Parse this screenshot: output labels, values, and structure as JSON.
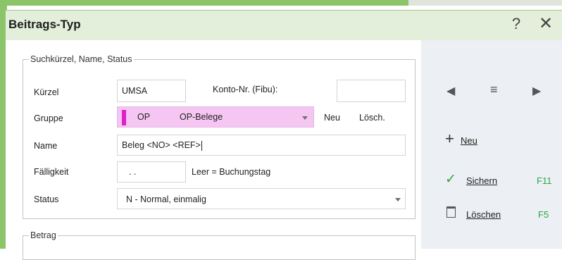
{
  "window": {
    "title": "Beitrags-Typ",
    "help_glyph": "?",
    "close_glyph": "✕"
  },
  "suchkuerzel_group": {
    "legend": "Suchkürzel, Name, Status",
    "kuerzel": {
      "label": "Kürzel",
      "value": "UMSA"
    },
    "konto": {
      "label": "Konto-Nr. (Fibu):",
      "value": ""
    },
    "gruppe": {
      "label": "Gruppe",
      "code": "OP",
      "name": "OP-Belege",
      "color": "#f6c6f2",
      "swatch_color": "#e020c8",
      "new_label": "Neu",
      "delete_label": "Lösch."
    },
    "name": {
      "label": "Name",
      "value": "Beleg <NO> <REF>"
    },
    "faelligkeit": {
      "label": "Fälligkeit",
      "value": ". .",
      "hint": "Leer = Buchungstag"
    },
    "status": {
      "label": "Status",
      "value": "N - Normal, einmalig"
    }
  },
  "betrag_group": {
    "legend": "Betrag"
  },
  "side": {
    "nav_prev": "◀",
    "nav_menu": "≡",
    "nav_next": "▶",
    "new_label": "Neu",
    "save_label": "Sichern",
    "save_key": "F11",
    "delete_label": "Löschen",
    "delete_key": "F5",
    "accent": "#28a745"
  }
}
